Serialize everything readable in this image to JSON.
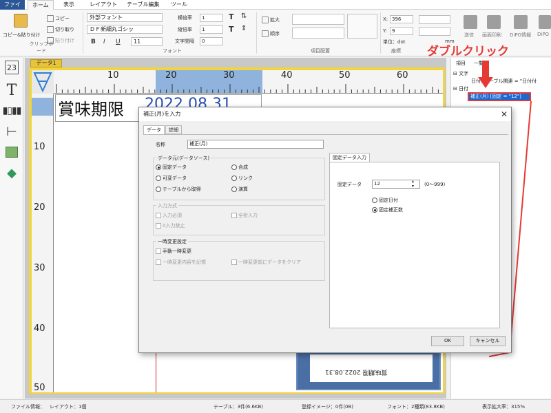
{
  "menu": {
    "tabs": [
      "ファイル",
      "ホーム",
      "表示",
      "レイアウト",
      "テーブル編集",
      "ツール"
    ]
  },
  "ribbon": {
    "clipboard": {
      "paste": "コピー&貼り付け",
      "copy": "コピー",
      "cut": "切り取り",
      "paste_small": "貼り付け",
      "group": "クリップボード"
    },
    "font": {
      "font_name": "外部フォント",
      "font_face": "ＤＦ新細丸ゴシッ",
      "size": "11",
      "group": "フォント",
      "bold": "B",
      "italic": "I",
      "underline": "U"
    },
    "spacing": {
      "h_ratio": "横倍率",
      "v_ratio": "縦倍率",
      "char_spacing": "文字間隔",
      "h_val": "1",
      "v_val": "1",
      "c_val": "0"
    },
    "arrange": {
      "zoom": "拡大",
      "order": "順序",
      "group": "項目配置"
    },
    "position": {
      "x_label": "X:",
      "x_val": "396",
      "y_label": "Y:",
      "y_val": "9",
      "unit": "単位：dot",
      "group": "座標",
      "unit_mm": "mm"
    },
    "right_tools": [
      "送信",
      "画面印刷",
      "DiPO情報",
      "DiPO"
    ]
  },
  "document_tab": "データ1",
  "ruler": {
    "h_numbers": [
      "10",
      "20",
      "30",
      "40",
      "50",
      "60"
    ],
    "v_numbers": [
      "10",
      "20",
      "30",
      "40",
      "50"
    ]
  },
  "canvas": {
    "label_text": "賞味期限",
    "label_date": "2022.08.31",
    "preview_text": "賞味期限 2022.08.31"
  },
  "annotation": {
    "text": "ダブルクリック"
  },
  "right_panel": {
    "tabs": [
      "項目",
      "一覧"
    ],
    "tree": [
      {
        "label": "文字",
        "indent": 0,
        "toggle": "⊟"
      },
      {
        "label": "日付 (テーブル関連 = \"日付付",
        "indent": 1,
        "toggle": ""
      },
      {
        "label": "日付",
        "indent": 0,
        "toggle": "⊟"
      }
    ],
    "selected": "補正(月) [固定 = \"12\"]"
  },
  "status": {
    "file_info": "ファイル情報：",
    "layout": "レイアウト：1個",
    "table": "テーブル：3件(6.6KB)",
    "images": "登録イメージ：0件(0B)",
    "fonts": "フォント：2種類(83.8KB)",
    "zoom": "表示拡大率：315%"
  },
  "dialog": {
    "title": "補正(月)を入力",
    "tabs": [
      "データ",
      "詳細"
    ],
    "name_label": "名称",
    "name_value": "補正(月)",
    "data_type_group": "データ元(データソース)",
    "data_types": [
      {
        "label": "固定データ",
        "checked": true
      },
      {
        "label": "合成",
        "checked": false
      },
      {
        "label": "可変データ",
        "checked": false
      },
      {
        "label": "リンク",
        "checked": false
      },
      {
        "label": "テーブルから取得",
        "checked": false
      },
      {
        "label": "演算",
        "checked": false
      }
    ],
    "input_method_group": "入力方式",
    "input_required": "入力必須",
    "full_width": "全桁入力",
    "no_zero_input": "0入力禁止",
    "temp_change_group": "一時変更設定",
    "manual_change": "手動一時変更",
    "save_change": "一時変更内容を記憶",
    "clear_change": "一時変更前にデータをクリア",
    "fixed_input_tab": "固定データ入力",
    "fixed_data_label": "固定データ",
    "fixed_data_value": "12",
    "fixed_data_range": "(0～999)",
    "fixed_options": [
      {
        "label": "固定日付",
        "checked": false
      },
      {
        "label": "固定補正数",
        "checked": true
      }
    ],
    "ok": "OK",
    "cancel": "キャンセル"
  }
}
